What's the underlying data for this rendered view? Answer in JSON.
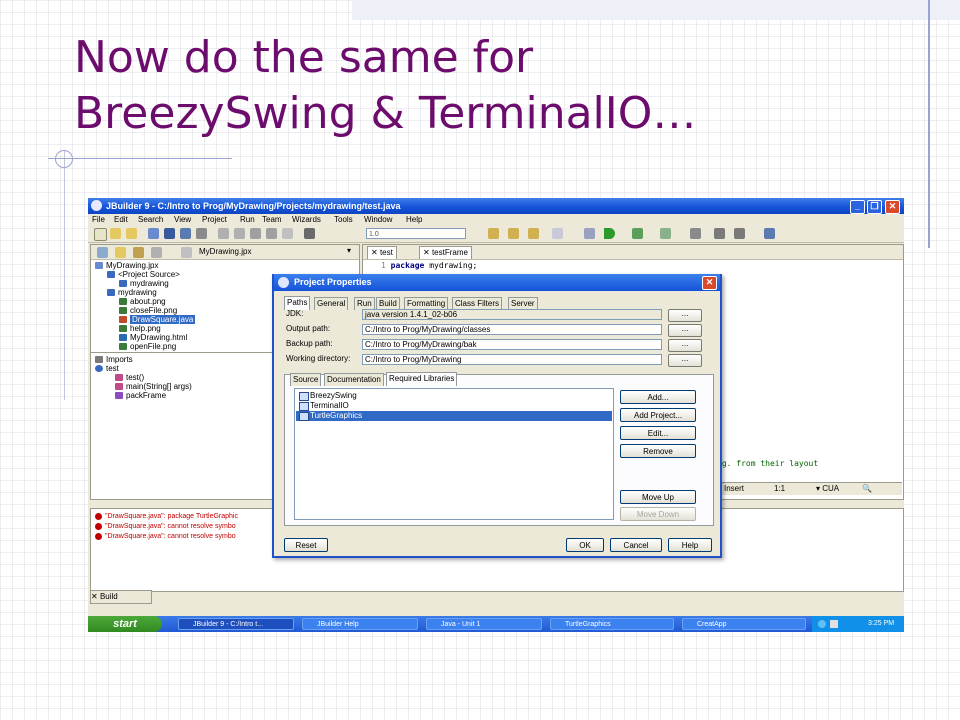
{
  "slide": {
    "title_line1": "Now do the same for",
    "title_line2": "BreezySwing & TerminalIO…"
  },
  "window": {
    "title": "JBuilder 9 - C:/Intro to Prog/MyDrawing/Projects/mydrawing/test.java",
    "menu": [
      "File",
      "Edit",
      "Search",
      "View",
      "Project",
      "Run",
      "Team",
      "Wizards",
      "Tools",
      "Window",
      "Help"
    ],
    "toolbar_input": "1.0"
  },
  "project_panel": {
    "file": "MyDrawing.jpx",
    "tree": [
      {
        "label": "MyDrawing.jpx",
        "indent": 0,
        "color": "#6a8ad0"
      },
      {
        "label": "<Project Source>",
        "indent": 1,
        "color": "#3a6ac0"
      },
      {
        "label": "mydrawing",
        "indent": 2,
        "color": "#3a6ac0"
      },
      {
        "label": "mydrawing",
        "indent": 1,
        "color": "#3a6ac0"
      },
      {
        "label": "about.png",
        "indent": 2,
        "color": "#3a7a3a"
      },
      {
        "label": "closeFile.png",
        "indent": 2,
        "color": "#3a7a3a"
      },
      {
        "label": "DrawSquare.java",
        "indent": 2,
        "color": "#c04a2a",
        "selected": true
      },
      {
        "label": "help.png",
        "indent": 2,
        "color": "#3a7a3a"
      },
      {
        "label": "MyDrawing.html",
        "indent": 2,
        "color": "#2a6ab0"
      },
      {
        "label": "openFile.png",
        "indent": 2,
        "color": "#3a7a3a"
      }
    ],
    "structure": [
      {
        "label": "Imports",
        "indent": 0,
        "color": "#7a7a7a"
      },
      {
        "label": "test",
        "indent": 0,
        "color": "#3a6ac0"
      },
      {
        "label": "test()",
        "indent": 2,
        "color": "#c04a8a"
      },
      {
        "label": "main(String[] args)",
        "indent": 2,
        "color": "#c04a8a"
      },
      {
        "label": "packFrame",
        "indent": 2,
        "color": "#8a4ac0"
      }
    ]
  },
  "editor": {
    "tabs": [
      "test",
      "testFrame"
    ],
    "line_number": "1",
    "code_keyword": "package",
    "code_rest": " mydrawing;",
    "partial_comment": ".g. from their layout",
    "status": {
      "mode": "Insert",
      "position": "1:1",
      "keymap": "CUA"
    }
  },
  "messages": [
    "\"DrawSquare.java\": package TurtleGraphic",
    "\"DrawSquare.java\": cannot resolve symbo",
    "\"DrawSquare.java\": cannot resolve symbo"
  ],
  "build_tab": "Build",
  "dialog": {
    "title": "Project Properties",
    "top_tabs": [
      "Paths",
      "General",
      "Run",
      "Build",
      "Formatting",
      "Class Filters",
      "Server"
    ],
    "fields": [
      {
        "label": "JDK:",
        "value": "java version 1.4.1_02-b06",
        "disabled": true
      },
      {
        "label": "Output path:",
        "value": "C:/Intro to Prog/MyDrawing/classes",
        "disabled": false
      },
      {
        "label": "Backup path:",
        "value": "C:/Intro to Prog/MyDrawing/bak",
        "disabled": false
      },
      {
        "label": "Working directory:",
        "value": "C:/Intro to Prog/MyDrawing",
        "disabled": false
      }
    ],
    "ellipsis": "...",
    "sub_tabs": [
      "Source",
      "Documentation",
      "Required Libraries"
    ],
    "libraries": [
      {
        "name": "BreezySwing",
        "selected": false
      },
      {
        "name": "TerminalIO",
        "selected": false
      },
      {
        "name": "TurtleGraphics",
        "selected": true
      }
    ],
    "side_buttons": {
      "add": "Add...",
      "add_project": "Add Project...",
      "edit": "Edit...",
      "remove": "Remove",
      "move_up": "Move Up",
      "move_down": "Move Down"
    },
    "bottom_buttons": {
      "reset": "Reset",
      "ok": "OK",
      "cancel": "Cancel",
      "help": "Help"
    }
  },
  "taskbar": {
    "start": "start",
    "items": [
      {
        "label": "JBuilder 9 - C:/Intro t...",
        "active": true
      },
      {
        "label": "JBuilder Help",
        "active": false
      },
      {
        "label": "Java - Unit 1",
        "active": false
      },
      {
        "label": "TurtleGraphics",
        "active": false
      },
      {
        "label": "CreatApp",
        "active": false
      }
    ],
    "clock": "3:25 PM"
  },
  "colors": {
    "title": "#6c0c6c",
    "xp_blue": "#1552d8",
    "selection": "#316ac5",
    "error": "#c00000"
  }
}
